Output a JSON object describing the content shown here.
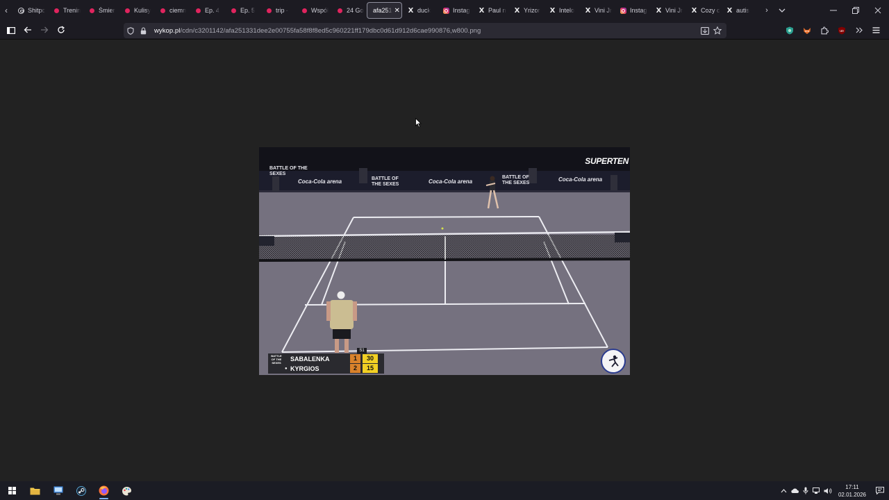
{
  "tabs": [
    {
      "label": "Shitpc",
      "favicon": "threads-icon"
    },
    {
      "label": "Trenin",
      "favicon": "youtube-icon"
    },
    {
      "label": "Śmier",
      "favicon": "youtube-icon"
    },
    {
      "label": "Kulisy",
      "favicon": "youtube-icon"
    },
    {
      "label": "ciemn",
      "favicon": "youtube-icon"
    },
    {
      "label": "Ep. 4",
      "favicon": "youtube-icon"
    },
    {
      "label": "Ep. 5",
      "favicon": "youtube-icon"
    },
    {
      "label": "trip -",
      "favicon": "youtube-icon"
    },
    {
      "label": "Współ",
      "favicon": "youtube-icon"
    },
    {
      "label": "24 Go",
      "favicon": "youtube-icon"
    },
    {
      "label": "afa251",
      "favicon": "none",
      "active": true
    },
    {
      "label": "duck",
      "favicon": "x-icon"
    },
    {
      "label": "Instag",
      "favicon": "instagram-icon"
    },
    {
      "label": "Paul n",
      "favicon": "x-threads-icon"
    },
    {
      "label": "Yrizor",
      "favicon": "x-icon"
    },
    {
      "label": "Intelo",
      "favicon": "x-icon"
    },
    {
      "label": "Vini Jr",
      "favicon": "x-threads-icon"
    },
    {
      "label": "Instag",
      "favicon": "instagram-icon"
    },
    {
      "label": "Vini Jr",
      "favicon": "x-icon"
    },
    {
      "label": "Cozy c",
      "favicon": "x-threads-icon"
    },
    {
      "label": "autis",
      "favicon": "x-threads-icon"
    }
  ],
  "url": {
    "host": "wykop.pl",
    "path": "/cdn/c3201142/afa251331dee2e00755fa58f8f8ed5c960221ff179dbc0d61d912d6cae990876,w800.png"
  },
  "scoreboard": {
    "logo_text": "BATTLE OF THE SEXES",
    "players": [
      {
        "name": "SABALENKA",
        "sets": "1",
        "points": "30",
        "serving": false
      },
      {
        "name": "KYRGIOS",
        "sets": "2",
        "points": "15",
        "serving": true
      }
    ],
    "set_marker": "S1"
  },
  "broadcast": {
    "bug": "SUPERTEN",
    "sponsor": "Coca-Cola arena",
    "event": "BATTLE OF THE SEXES"
  },
  "clock": {
    "time": "17:11",
    "date": "02.01.2026"
  },
  "colors": {
    "tab_bg": "#1c1b22",
    "url_bg": "#2b2a33",
    "page_bg": "#222222",
    "court": "#75717f",
    "taskbar": "#1b1c24"
  }
}
